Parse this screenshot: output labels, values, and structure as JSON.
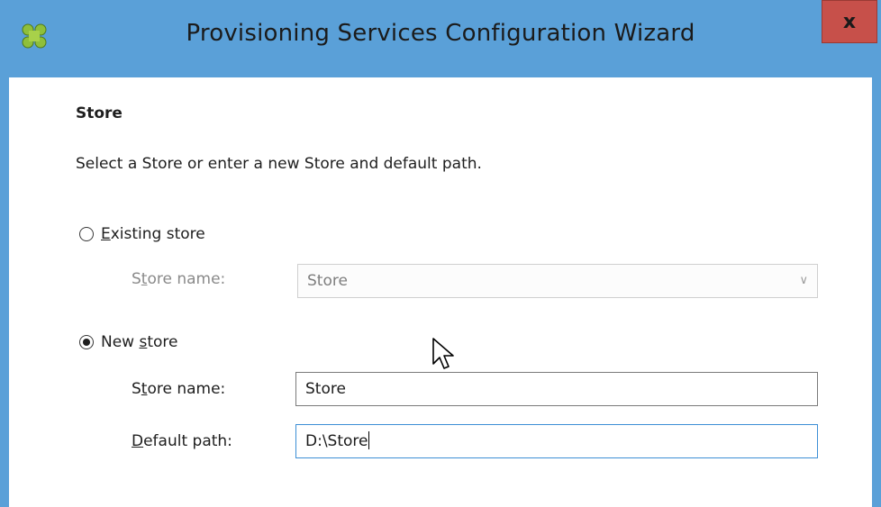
{
  "window": {
    "title": "Provisioning Services Configuration Wizard",
    "close_label": "x"
  },
  "page": {
    "heading": "Store",
    "description": "Select a Store or enter a new Store and default path."
  },
  "existing_store": {
    "radio_label_first": "E",
    "radio_label_rest": "xisting store",
    "selected": false,
    "store_name_label_a": "S",
    "store_name_label_u": "t",
    "store_name_label_b": "ore name:",
    "store_name_value": "Store"
  },
  "new_store": {
    "radio_label_a": "New ",
    "radio_label_u": "s",
    "radio_label_b": "tore",
    "selected": true,
    "store_name_label_a": "S",
    "store_name_label_u": "t",
    "store_name_label_b": "ore name:",
    "store_name_value": "Store",
    "default_path_label_u": "D",
    "default_path_label_b": "efault path:",
    "default_path_value": "D:\\Store"
  },
  "icons": {
    "app": "citrix-provisioning-icon",
    "combo_arrow": "chevron-down-icon",
    "cursor": "mouse-pointer-icon"
  },
  "colors": {
    "title_bar": "#5aa0d8",
    "close_button": "#c7504a",
    "focus_border": "#3d8fd6"
  }
}
